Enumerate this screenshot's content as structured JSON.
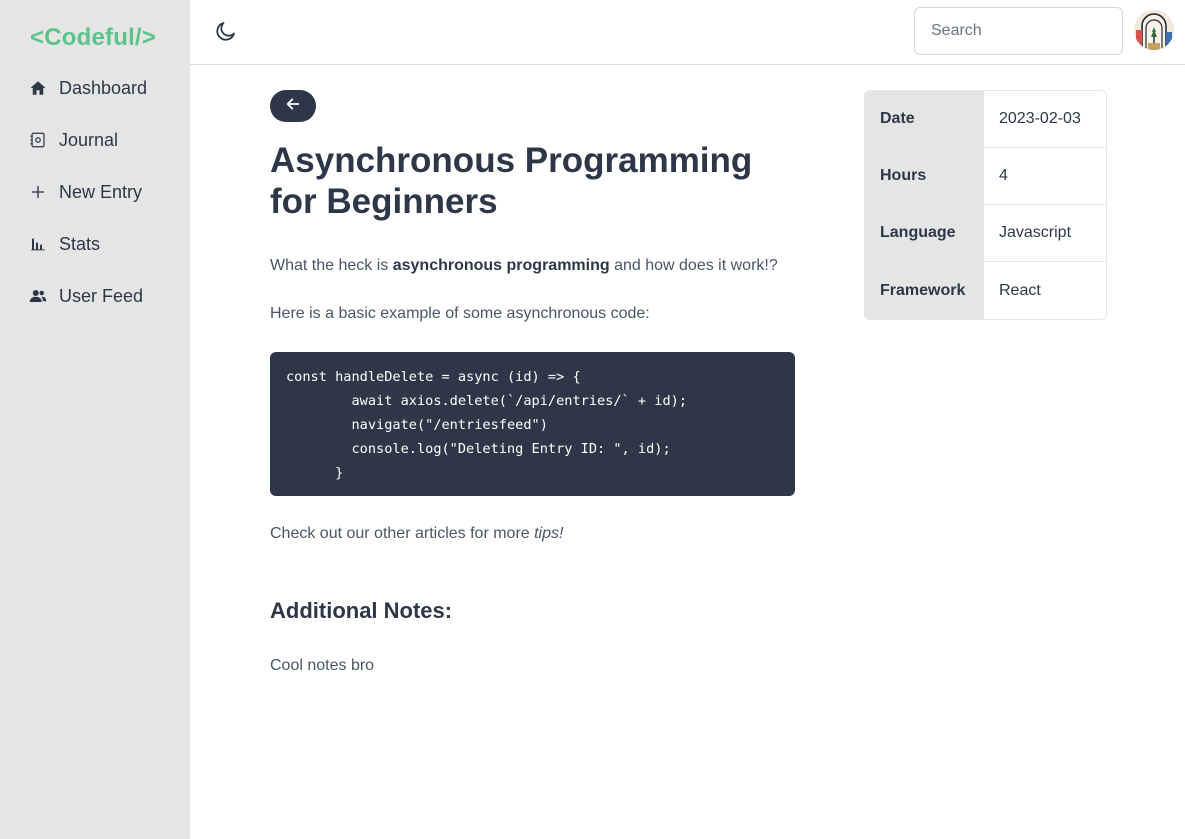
{
  "sidebar": {
    "logo": "<Codeful/>",
    "items": [
      {
        "label": "Dashboard",
        "icon": "home-icon"
      },
      {
        "label": "Journal",
        "icon": "journal-icon"
      },
      {
        "label": "New Entry",
        "icon": "plus-icon"
      },
      {
        "label": "Stats",
        "icon": "bar-chart-icon"
      },
      {
        "label": "User Feed",
        "icon": "users-icon"
      }
    ]
  },
  "header": {
    "theme_toggle_icon": "moon-icon",
    "search_placeholder": "Search",
    "avatar_icon": "avatar-image"
  },
  "article": {
    "back_icon": "arrow-left-icon",
    "title": "Asynchronous Programming for Beginners",
    "intro_before": "What the heck is ",
    "intro_bold": "asynchronous programming",
    "intro_after": " and how does it work!?",
    "example_text": "Here is a basic example of some asynchronous code:",
    "code": "const handleDelete = async (id) => {\n        await axios.delete(`/api/entries/` + id);\n        navigate(\"/entriesfeed\")\n        console.log(\"Deleting Entry ID: \", id);\n      }",
    "outro_before": "Check out our other articles for more ",
    "outro_italic": "tips!",
    "notes_heading": "Additional Notes:",
    "notes_text": "Cool notes bro"
  },
  "meta": [
    {
      "key": "Date",
      "value": "2023-02-03"
    },
    {
      "key": "Hours",
      "value": "4"
    },
    {
      "key": "Language",
      "value": "Javascript"
    },
    {
      "key": "Framework",
      "value": "React"
    }
  ],
  "colors": {
    "brand": "#5cc48a",
    "sidebar_bg": "#e5e5e5",
    "dark": "#2d3748"
  }
}
